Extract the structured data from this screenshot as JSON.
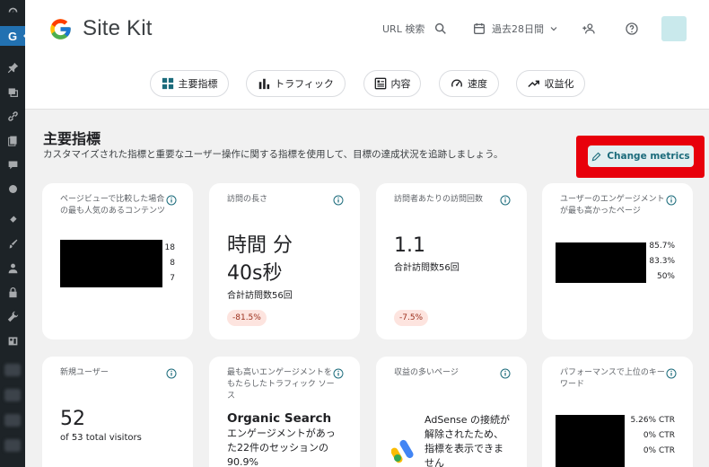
{
  "header": {
    "app_title": "Site Kit",
    "url_search_label": "URL 検索",
    "date_range_label": "過去28日間"
  },
  "tabs": [
    {
      "label": "主要指標"
    },
    {
      "label": "トラフィック"
    },
    {
      "label": "内容"
    },
    {
      "label": "速度"
    },
    {
      "label": "収益化"
    }
  ],
  "section": {
    "title": "主要指標",
    "description": "カスタマイズされた指標と重要なユーザー操作に関する指標を使用して、目標の達成状況を追跡しましょう。",
    "change_metrics_label": "Change metrics"
  },
  "cards": {
    "popular_content": {
      "title": "ページビューで比較した場合の最も人気のあるコンテンツ",
      "values": [
        "18",
        "8",
        "7"
      ]
    },
    "visit_length": {
      "title": "訪問の長さ",
      "value_line1": "時間 分",
      "value_line2": "40s秒",
      "subtext": "合計訪問数56回",
      "change": "-81.5%"
    },
    "visits_per_visitor": {
      "title": "訪問者あたりの訪問回数",
      "value": "1.1",
      "subtext": "合計訪問数56回",
      "change": "-7.5%"
    },
    "engaged_pages": {
      "title": "ユーザーのエンゲージメントが最も高かったページ",
      "values": [
        "85.7%",
        "83.3%",
        "50%"
      ]
    },
    "new_users": {
      "title": "新規ユーザー",
      "value": "52",
      "subtext": "of 53 total visitors"
    },
    "top_traffic_source": {
      "title": "最も高いエンゲージメントをもたらしたトラフィック ソース",
      "value": "Organic Search",
      "line1": "エンゲージメントがあっ",
      "line2": "た22件のセッションの",
      "line3": "90.9%"
    },
    "top_earning_pages": {
      "title": "収益の多いページ",
      "line1": "AdSense の接続が",
      "line2": "解除されたため、",
      "line3": "指標を表示できま",
      "line4": "せん"
    },
    "top_ctr_keywords": {
      "title": "パフォーマンスで上位のキーワード",
      "values": [
        "5.26% CTR",
        "0% CTR",
        "0% CTR"
      ]
    }
  },
  "colors": {
    "accent": "#1b6b7b",
    "highlight": "#e8000b",
    "badge_bg": "#fde4df"
  }
}
